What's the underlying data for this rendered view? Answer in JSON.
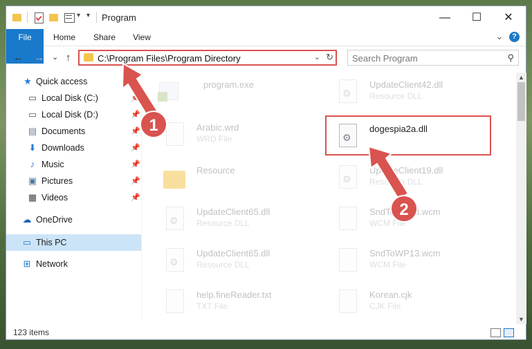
{
  "window": {
    "title": "Program",
    "min_glyph": "—",
    "max_glyph": "☐",
    "close_glyph": "✕"
  },
  "ribbon": {
    "tabs": [
      {
        "label": "File"
      },
      {
        "label": "Home"
      },
      {
        "label": "Share"
      },
      {
        "label": "View"
      }
    ],
    "expand_glyph": "⌄",
    "help_glyph": "?"
  },
  "nav": {
    "back_glyph": "←",
    "forward_glyph": "→",
    "recent_glyph": "⌄",
    "up_glyph": "↑",
    "address_path": "C:\\Program Files\\Program Directory",
    "address_dropdown_glyph": "⌄",
    "refresh_glyph": "↻",
    "search_placeholder": "Search Program",
    "search_glyph": "⚲"
  },
  "sidebar": {
    "items": [
      {
        "label": "Quick access",
        "icon": "star-icon",
        "glyph": "★"
      },
      {
        "label": "Local Disk (C:)",
        "icon": "drive-icon",
        "glyph": "▭"
      },
      {
        "label": "Local Disk (D:)",
        "icon": "drive-icon",
        "glyph": "▭"
      },
      {
        "label": "Documents",
        "icon": "documents-icon",
        "glyph": "▤"
      },
      {
        "label": "Downloads",
        "icon": "downloads-icon",
        "glyph": "⬇"
      },
      {
        "label": "Music",
        "icon": "music-icon",
        "glyph": "♪"
      },
      {
        "label": "Pictures",
        "icon": "pictures-icon",
        "glyph": "▣"
      },
      {
        "label": "Videos",
        "icon": "videos-icon",
        "glyph": "▦"
      },
      {
        "label": "OneDrive",
        "icon": "onedrive-icon",
        "glyph": "☁"
      },
      {
        "label": "This PC",
        "icon": "this-pc-icon",
        "glyph": "▭"
      },
      {
        "label": "Network",
        "icon": "network-icon",
        "glyph": "⊞"
      }
    ],
    "pin_glyph": "📌"
  },
  "files": [
    {
      "name": "program.exe",
      "type": ""
    },
    {
      "name": "UpdateClient42.dll",
      "type": "Resource DLL"
    },
    {
      "name": "Arabic.wrd",
      "type": "WRD File"
    },
    {
      "name": "dogespia2a.dll",
      "type": ""
    },
    {
      "name": "Resource",
      "type": ""
    },
    {
      "name": "UpdateClient19.dll",
      "type": "Resource DLL"
    },
    {
      "name": "UpdateClient65.dll",
      "type": "Resource DLL"
    },
    {
      "name": "SndToWP13.wcm",
      "type": "WCM File"
    },
    {
      "name": "UpdateClient65.dll",
      "type": "Resource DLL"
    },
    {
      "name": "SndToWP13.wcm",
      "type": "WCM File"
    },
    {
      "name": "help.fineReader.txt",
      "type": "TXT File"
    },
    {
      "name": "Korean.cjk",
      "type": "CJK File"
    }
  ],
  "status": {
    "item_count": "123 items"
  },
  "annotations": {
    "badge_1": "1",
    "badge_2": "2",
    "color": "#d9534f"
  }
}
